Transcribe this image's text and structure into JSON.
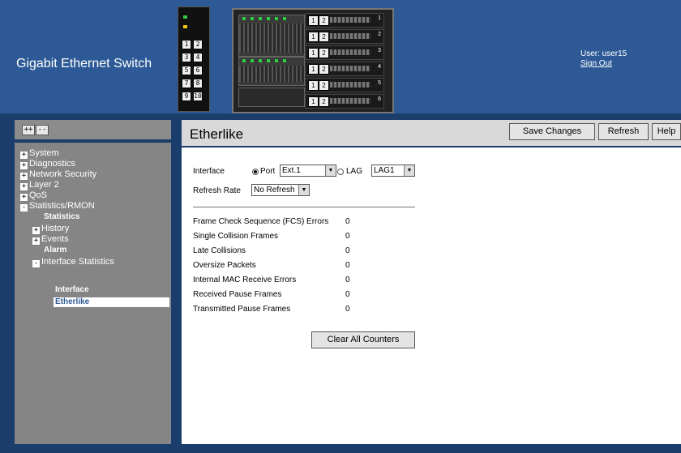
{
  "header": {
    "brand": "Gigabit Ethernet Switch",
    "user_label": "User: user15",
    "sign_out": "Sign Out",
    "left_ports": [
      "1",
      "2",
      "3",
      "4",
      "5",
      "6",
      "7",
      "8",
      "9",
      "10"
    ],
    "module_numbers": [
      "1",
      "2",
      "3",
      "4",
      "5",
      "6"
    ],
    "module_buttons": [
      "1",
      "2"
    ]
  },
  "sidebar": {
    "expand_all": "++",
    "collapse_all": "--",
    "items": [
      {
        "label": "System",
        "icon": "+"
      },
      {
        "label": "Diagnostics",
        "icon": "+"
      },
      {
        "label": "Network Security",
        "icon": "+"
      },
      {
        "label": "Layer 2",
        "icon": "+"
      },
      {
        "label": "QoS",
        "icon": "+"
      },
      {
        "label": "Statistics/RMON",
        "icon": "-"
      },
      {
        "label": "Statistics"
      },
      {
        "label": "History",
        "icon": "+"
      },
      {
        "label": "Events",
        "icon": "+"
      },
      {
        "label": "Alarm"
      },
      {
        "label": "Interface Statistics",
        "icon": "-"
      },
      {
        "label": "Interface"
      },
      {
        "label": "Etherlike"
      }
    ]
  },
  "toolbar": {
    "title": "Etherlike",
    "save": "Save Changes",
    "refresh": "Refresh",
    "help": "Help"
  },
  "form": {
    "interface_label": "Interface",
    "port_label": "Port",
    "port_value": "Ext.1",
    "lag_label": "LAG",
    "lag_value": "LAG1",
    "refresh_rate_label": "Refresh Rate",
    "refresh_rate_value": "No Refresh"
  },
  "stats": [
    {
      "label": "Frame Check Sequence (FCS) Errors",
      "value": "0"
    },
    {
      "label": "Single Collision Frames",
      "value": "0"
    },
    {
      "label": "Late Collisions",
      "value": "0"
    },
    {
      "label": "Oversize Packets",
      "value": "0"
    },
    {
      "label": "Internal MAC Receive Errors",
      "value": "0"
    },
    {
      "label": "Received Pause Frames",
      "value": "0"
    },
    {
      "label": "Transmitted Pause Frames",
      "value": "0"
    }
  ],
  "clear_button": "Clear All Counters",
  "colors": {
    "header": "#2d5a96",
    "sidebar": "#858585",
    "background": "#1b3d6b"
  }
}
